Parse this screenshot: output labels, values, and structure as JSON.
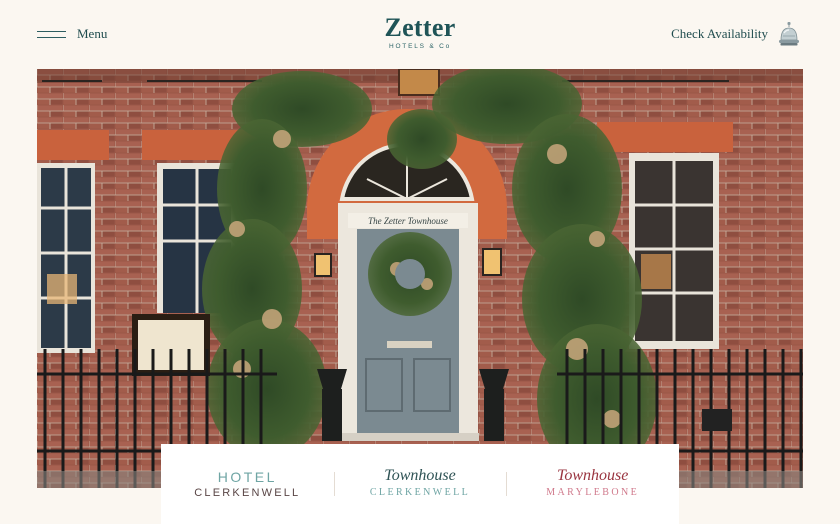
{
  "header": {
    "menu_label": "Menu",
    "logo_title": "Zetter",
    "logo_subtitle": "HOTELS & Co",
    "availability_label": "Check Availability"
  },
  "hero": {
    "door_sign": "The Zetter Townhouse",
    "slide_count": 3,
    "active_slide": 2
  },
  "hotels": [
    {
      "line1": "HOTEL",
      "line2": "CLERKENWELL"
    },
    {
      "line1": "Townhouse",
      "line2": "CLERKENWELL"
    },
    {
      "line1": "Townhouse",
      "line2": "MARYLEBONE"
    }
  ],
  "colors": {
    "background": "#fbf7f1",
    "brand_teal": "#1f5457",
    "accent_mint": "#6fa5a4",
    "accent_rose": "#9a3540",
    "accent_pink": "#d07a8c"
  }
}
